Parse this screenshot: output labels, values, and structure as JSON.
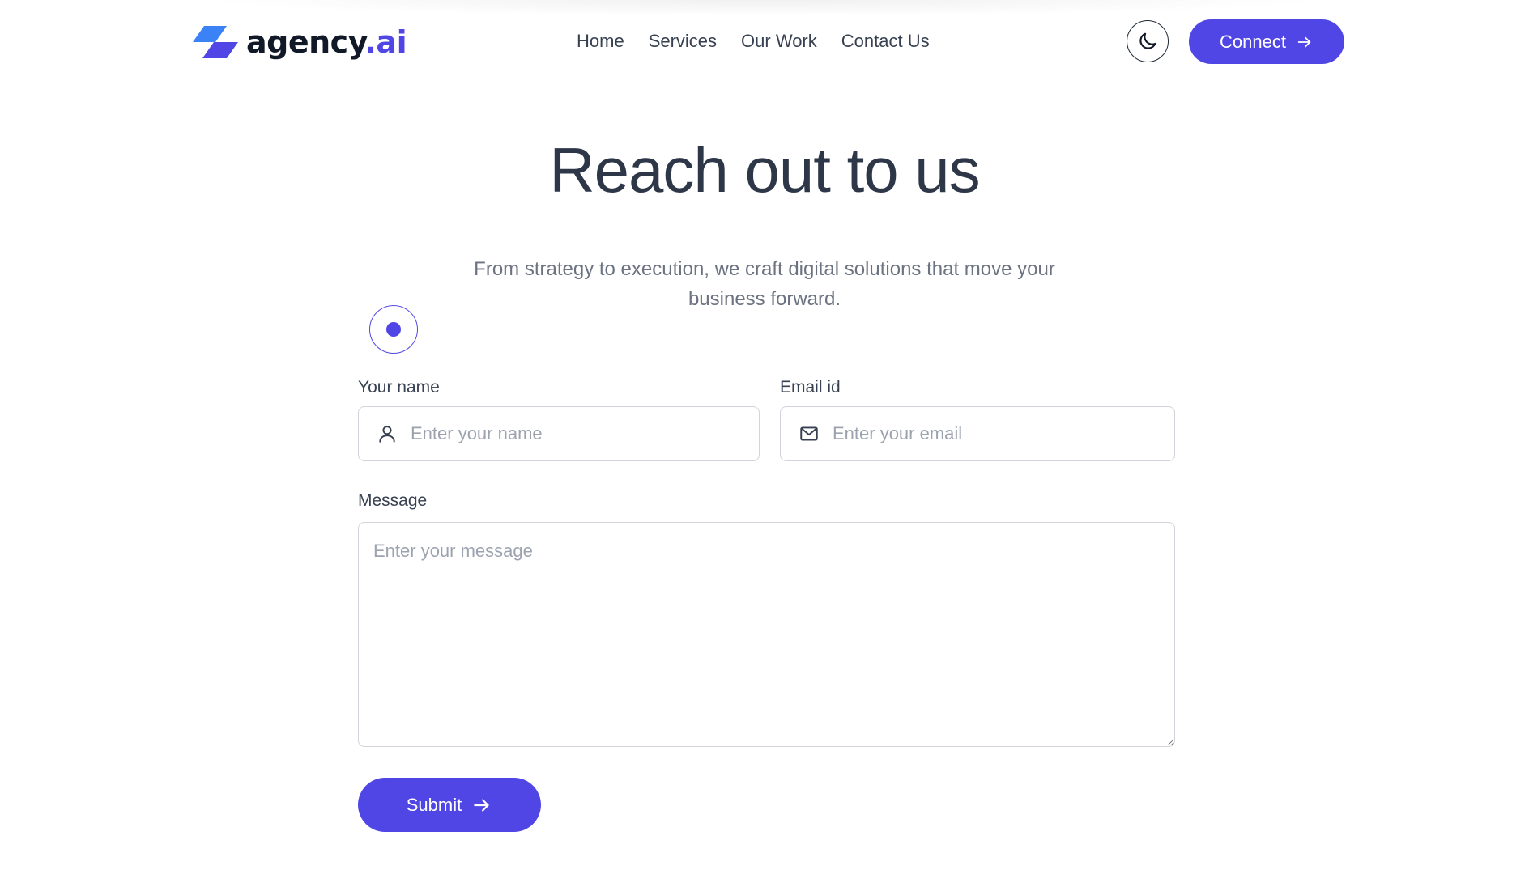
{
  "brand": {
    "name": "agency",
    "accent": ".ai",
    "color_primary": "#4f46e5"
  },
  "nav": {
    "items": [
      {
        "label": "Home"
      },
      {
        "label": "Services"
      },
      {
        "label": "Our Work"
      },
      {
        "label": "Contact Us"
      }
    ]
  },
  "header": {
    "theme_toggle_icon": "moon-icon",
    "connect_label": "Connect",
    "connect_icon": "arrow-right-icon"
  },
  "hero": {
    "title": "Reach out to us",
    "subtitle": "From strategy to execution, we craft digital solutions that move your business forward."
  },
  "form": {
    "name": {
      "label": "Your name",
      "placeholder": "Enter your name",
      "value": "",
      "icon": "user-icon"
    },
    "email": {
      "label": "Email id",
      "placeholder": "Enter your email",
      "value": "",
      "icon": "mail-icon"
    },
    "message": {
      "label": "Message",
      "placeholder": "Enter your message",
      "value": ""
    },
    "submit_label": "Submit",
    "submit_icon": "arrow-right-icon"
  }
}
